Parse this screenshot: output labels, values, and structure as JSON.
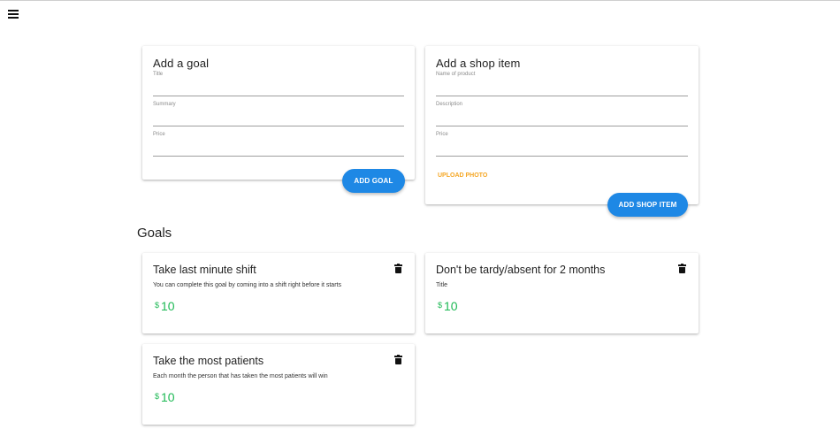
{
  "add_goal": {
    "title": "Add a goal",
    "fields": [
      {
        "label": "Title",
        "value": ""
      },
      {
        "label": "Summary",
        "value": ""
      },
      {
        "label": "Price",
        "value": ""
      }
    ],
    "button": "ADD GOAL"
  },
  "add_shop_item": {
    "title": "Add a shop item",
    "fields": [
      {
        "label": "Name of product",
        "value": ""
      },
      {
        "label": "Description",
        "value": ""
      },
      {
        "label": "Price",
        "value": ""
      }
    ],
    "upload": "UPLOAD PHOTO",
    "button": "ADD SHOP ITEM"
  },
  "goals": {
    "heading": "Goals",
    "currency": "$",
    "items": [
      {
        "title": "Take last minute shift",
        "summary": "You can complete this goal by coming into a shift right before it starts",
        "price": "10"
      },
      {
        "title": "Don't be tardy/absent for 2 months",
        "summary": "Title",
        "price": "10"
      },
      {
        "title": "Take the most patients",
        "summary": "Each month the person that has taken the most patients will win",
        "price": "10"
      }
    ]
  },
  "colors": {
    "accent": "#1e88e5",
    "price": "#1db954",
    "upload": "#f5a623"
  },
  "icons": {
    "menu": "menu-icon",
    "delete": "trash-icon"
  }
}
